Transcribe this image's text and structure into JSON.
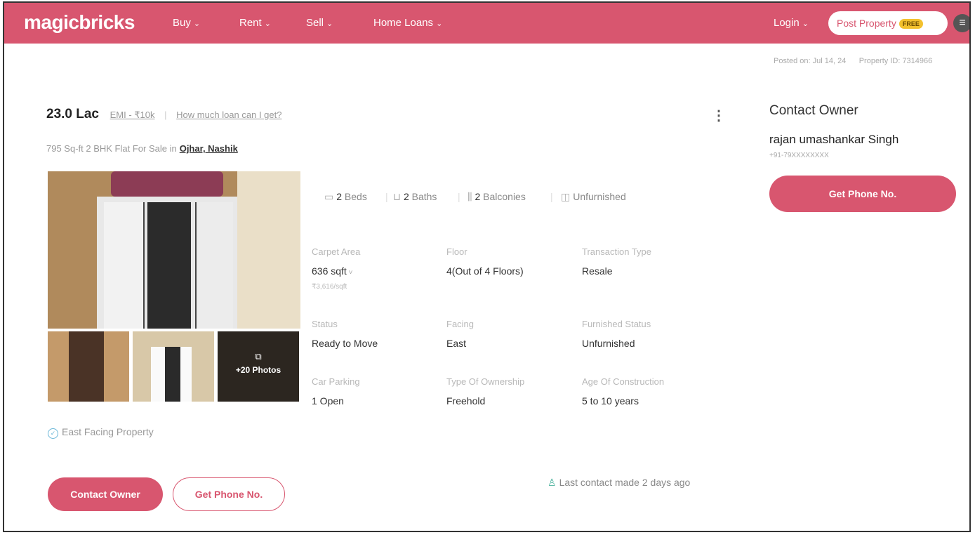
{
  "nav": {
    "logo": "magicbricks",
    "items": [
      "Buy",
      "Rent",
      "Sell",
      "Home Loans"
    ],
    "login": "Login",
    "post_property": "Post Property",
    "free_badge": "FREE",
    "menu_icon": "hamburger-icon"
  },
  "meta": {
    "posted": "Posted on: Jul 14, 24",
    "property_id": "Property ID: 7314966"
  },
  "listing": {
    "price": "23.0 Lac",
    "emi": "EMI - ₹10k",
    "loan_link": "How much loan can I get?",
    "subtitle": "795 Sq-ft 2 BHK Flat For Sale in",
    "location": "Ojhar, Nashik",
    "photos_count": "+20 Photos",
    "amenities": [
      {
        "icon": "bed-icon",
        "value": "2",
        "label": "Beds"
      },
      {
        "icon": "bath-icon",
        "value": "2",
        "label": "Baths"
      },
      {
        "icon": "balcony-icon",
        "value": "2",
        "label": "Balconies"
      },
      {
        "icon": "furniture-icon",
        "value": "",
        "label": "Unfurnished"
      }
    ],
    "details": [
      {
        "label": "Carpet Area",
        "value": "636 sqft",
        "sub": "₹3,616/sqft"
      },
      {
        "label": "Floor",
        "value": "4(Out of 4 Floors)"
      },
      {
        "label": "Transaction Type",
        "value": "Resale"
      },
      {
        "label": "Status",
        "value": "Ready to Move"
      },
      {
        "label": "Facing",
        "value": "East"
      },
      {
        "label": "Furnished Status",
        "value": "Unfurnished"
      },
      {
        "label": "Car Parking",
        "value": "1 Open"
      },
      {
        "label": "Type Of Ownership",
        "value": "Freehold"
      },
      {
        "label": "Age Of Construction",
        "value": "5 to 10 years"
      }
    ],
    "facing_tag": "East Facing Property",
    "contact_owner_btn": "Contact Owner",
    "get_phone_btn": "Get Phone No.",
    "last_contact": "Last contact made 2 days ago"
  },
  "sidebar": {
    "title": "Contact Owner",
    "owner_name": "rajan umashankar Singh",
    "owner_phone": "+91-79XXXXXXXX",
    "get_phone_btn": "Get Phone No."
  },
  "colors": {
    "brand": "#d8566f",
    "free_badge": "#f3c12e"
  }
}
